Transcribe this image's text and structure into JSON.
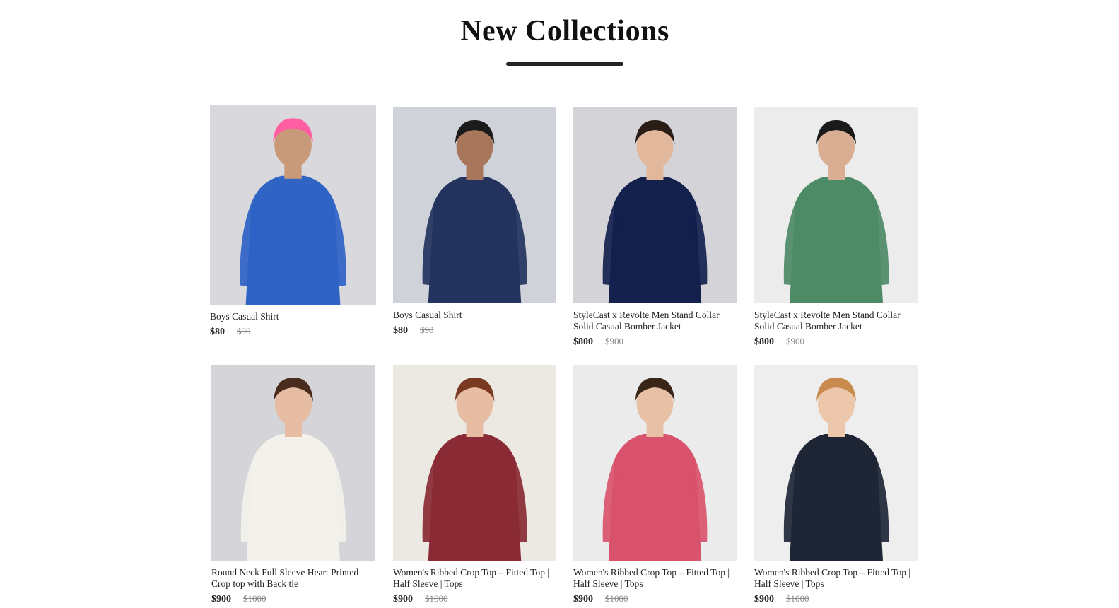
{
  "section": {
    "title": "New Collections"
  },
  "products": [
    {
      "name": "Boys Casual Shirt",
      "price": "$80",
      "old_price": "$90",
      "bg": "#d9d9dd",
      "garment": "#2f63c4",
      "skin": "#c89a7a",
      "hair": "#ff5fa2",
      "lower": "#e8dcc6"
    },
    {
      "name": "Boys Casual Shirt",
      "price": "$80",
      "old_price": "$90",
      "bg": "#cfd2d8",
      "garment": "#23335e",
      "skin": "#a8765a",
      "hair": "#1b1b1b",
      "lower": "#23335e"
    },
    {
      "name": "StyleCast x Revolte Men Stand Collar Solid Casual Bomber Jacket",
      "price": "$800",
      "old_price": "$900",
      "bg": "#d4d4d8",
      "garment": "#14214d",
      "skin": "#e2b89c",
      "hair": "#2a1d16",
      "lower": "#ffffff"
    },
    {
      "name": "StyleCast x Revolte Men Stand Collar Solid Casual Bomber Jacket",
      "price": "$800",
      "old_price": "$900",
      "bg": "#ececec",
      "garment": "#4d8a66",
      "skin": "#d9ae92",
      "hair": "#1a1a1a",
      "lower": "#4d8a66"
    },
    {
      "name": "Round Neck Full Sleeve Heart Printed Crop top with Back tie",
      "price": "$900",
      "old_price": "$1000",
      "bg": "#d4d4d9",
      "garment": "#f3f1ea",
      "skin": "#e6bda3",
      "hair": "#4a2c1e",
      "lower": "#1f3b33"
    },
    {
      "name": "Women's Ribbed Crop Top – Fitted Top | Half Sleeve | Tops",
      "price": "$900",
      "old_price": "$1000",
      "bg": "#ece8e2",
      "garment": "#8a2a34",
      "skin": "#e6bda3",
      "hair": "#7a3a22",
      "lower": "#1c1c1c"
    },
    {
      "name": "Women's Ribbed Crop Top – Fitted Top | Half Sleeve | Tops",
      "price": "$900",
      "old_price": "$1000",
      "bg": "#ebebeb",
      "garment": "#d9536d",
      "skin": "#e8c0a6",
      "hair": "#3a2519",
      "lower": "#c9314f"
    },
    {
      "name": "Women's Ribbed Crop Top – Fitted Top | Half Sleeve | Tops",
      "price": "$900",
      "old_price": "$1000",
      "bg": "#eeeeee",
      "garment": "#1e2636",
      "skin": "#edc7ac",
      "hair": "#c98a4e",
      "lower": "#9bb3cf"
    }
  ]
}
